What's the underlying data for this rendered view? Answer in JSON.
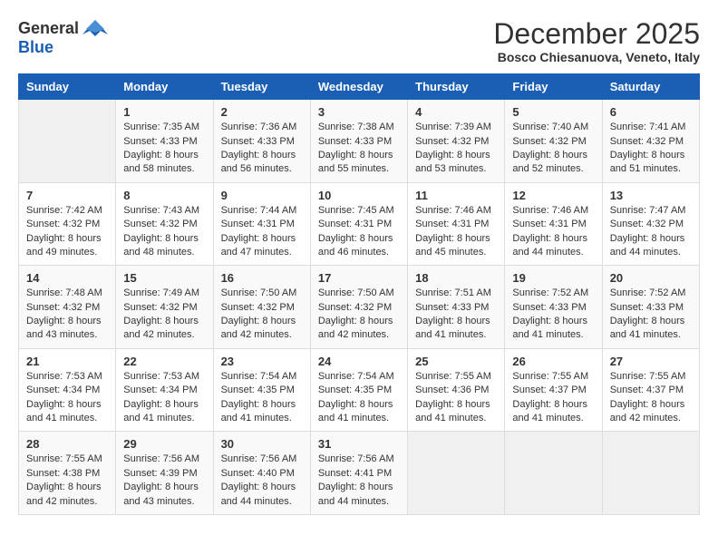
{
  "header": {
    "logo_general": "General",
    "logo_blue": "Blue",
    "month": "December 2025",
    "location": "Bosco Chiesanuova, Veneto, Italy"
  },
  "weekdays": [
    "Sunday",
    "Monday",
    "Tuesday",
    "Wednesday",
    "Thursday",
    "Friday",
    "Saturday"
  ],
  "weeks": [
    [
      {
        "day": null,
        "info": null
      },
      {
        "day": "1",
        "sunrise": "Sunrise: 7:35 AM",
        "sunset": "Sunset: 4:33 PM",
        "daylight": "Daylight: 8 hours and 58 minutes."
      },
      {
        "day": "2",
        "sunrise": "Sunrise: 7:36 AM",
        "sunset": "Sunset: 4:33 PM",
        "daylight": "Daylight: 8 hours and 56 minutes."
      },
      {
        "day": "3",
        "sunrise": "Sunrise: 7:38 AM",
        "sunset": "Sunset: 4:33 PM",
        "daylight": "Daylight: 8 hours and 55 minutes."
      },
      {
        "day": "4",
        "sunrise": "Sunrise: 7:39 AM",
        "sunset": "Sunset: 4:32 PM",
        "daylight": "Daylight: 8 hours and 53 minutes."
      },
      {
        "day": "5",
        "sunrise": "Sunrise: 7:40 AM",
        "sunset": "Sunset: 4:32 PM",
        "daylight": "Daylight: 8 hours and 52 minutes."
      },
      {
        "day": "6",
        "sunrise": "Sunrise: 7:41 AM",
        "sunset": "Sunset: 4:32 PM",
        "daylight": "Daylight: 8 hours and 51 minutes."
      }
    ],
    [
      {
        "day": "7",
        "sunrise": "Sunrise: 7:42 AM",
        "sunset": "Sunset: 4:32 PM",
        "daylight": "Daylight: 8 hours and 49 minutes."
      },
      {
        "day": "8",
        "sunrise": "Sunrise: 7:43 AM",
        "sunset": "Sunset: 4:32 PM",
        "daylight": "Daylight: 8 hours and 48 minutes."
      },
      {
        "day": "9",
        "sunrise": "Sunrise: 7:44 AM",
        "sunset": "Sunset: 4:31 PM",
        "daylight": "Daylight: 8 hours and 47 minutes."
      },
      {
        "day": "10",
        "sunrise": "Sunrise: 7:45 AM",
        "sunset": "Sunset: 4:31 PM",
        "daylight": "Daylight: 8 hours and 46 minutes."
      },
      {
        "day": "11",
        "sunrise": "Sunrise: 7:46 AM",
        "sunset": "Sunset: 4:31 PM",
        "daylight": "Daylight: 8 hours and 45 minutes."
      },
      {
        "day": "12",
        "sunrise": "Sunrise: 7:46 AM",
        "sunset": "Sunset: 4:31 PM",
        "daylight": "Daylight: 8 hours and 44 minutes."
      },
      {
        "day": "13",
        "sunrise": "Sunrise: 7:47 AM",
        "sunset": "Sunset: 4:32 PM",
        "daylight": "Daylight: 8 hours and 44 minutes."
      }
    ],
    [
      {
        "day": "14",
        "sunrise": "Sunrise: 7:48 AM",
        "sunset": "Sunset: 4:32 PM",
        "daylight": "Daylight: 8 hours and 43 minutes."
      },
      {
        "day": "15",
        "sunrise": "Sunrise: 7:49 AM",
        "sunset": "Sunset: 4:32 PM",
        "daylight": "Daylight: 8 hours and 42 minutes."
      },
      {
        "day": "16",
        "sunrise": "Sunrise: 7:50 AM",
        "sunset": "Sunset: 4:32 PM",
        "daylight": "Daylight: 8 hours and 42 minutes."
      },
      {
        "day": "17",
        "sunrise": "Sunrise: 7:50 AM",
        "sunset": "Sunset: 4:32 PM",
        "daylight": "Daylight: 8 hours and 42 minutes."
      },
      {
        "day": "18",
        "sunrise": "Sunrise: 7:51 AM",
        "sunset": "Sunset: 4:33 PM",
        "daylight": "Daylight: 8 hours and 41 minutes."
      },
      {
        "day": "19",
        "sunrise": "Sunrise: 7:52 AM",
        "sunset": "Sunset: 4:33 PM",
        "daylight": "Daylight: 8 hours and 41 minutes."
      },
      {
        "day": "20",
        "sunrise": "Sunrise: 7:52 AM",
        "sunset": "Sunset: 4:33 PM",
        "daylight": "Daylight: 8 hours and 41 minutes."
      }
    ],
    [
      {
        "day": "21",
        "sunrise": "Sunrise: 7:53 AM",
        "sunset": "Sunset: 4:34 PM",
        "daylight": "Daylight: 8 hours and 41 minutes."
      },
      {
        "day": "22",
        "sunrise": "Sunrise: 7:53 AM",
        "sunset": "Sunset: 4:34 PM",
        "daylight": "Daylight: 8 hours and 41 minutes."
      },
      {
        "day": "23",
        "sunrise": "Sunrise: 7:54 AM",
        "sunset": "Sunset: 4:35 PM",
        "daylight": "Daylight: 8 hours and 41 minutes."
      },
      {
        "day": "24",
        "sunrise": "Sunrise: 7:54 AM",
        "sunset": "Sunset: 4:35 PM",
        "daylight": "Daylight: 8 hours and 41 minutes."
      },
      {
        "day": "25",
        "sunrise": "Sunrise: 7:55 AM",
        "sunset": "Sunset: 4:36 PM",
        "daylight": "Daylight: 8 hours and 41 minutes."
      },
      {
        "day": "26",
        "sunrise": "Sunrise: 7:55 AM",
        "sunset": "Sunset: 4:37 PM",
        "daylight": "Daylight: 8 hours and 41 minutes."
      },
      {
        "day": "27",
        "sunrise": "Sunrise: 7:55 AM",
        "sunset": "Sunset: 4:37 PM",
        "daylight": "Daylight: 8 hours and 42 minutes."
      }
    ],
    [
      {
        "day": "28",
        "sunrise": "Sunrise: 7:55 AM",
        "sunset": "Sunset: 4:38 PM",
        "daylight": "Daylight: 8 hours and 42 minutes."
      },
      {
        "day": "29",
        "sunrise": "Sunrise: 7:56 AM",
        "sunset": "Sunset: 4:39 PM",
        "daylight": "Daylight: 8 hours and 43 minutes."
      },
      {
        "day": "30",
        "sunrise": "Sunrise: 7:56 AM",
        "sunset": "Sunset: 4:40 PM",
        "daylight": "Daylight: 8 hours and 44 minutes."
      },
      {
        "day": "31",
        "sunrise": "Sunrise: 7:56 AM",
        "sunset": "Sunset: 4:41 PM",
        "daylight": "Daylight: 8 hours and 44 minutes."
      },
      {
        "day": null,
        "info": null
      },
      {
        "day": null,
        "info": null
      },
      {
        "day": null,
        "info": null
      }
    ]
  ]
}
